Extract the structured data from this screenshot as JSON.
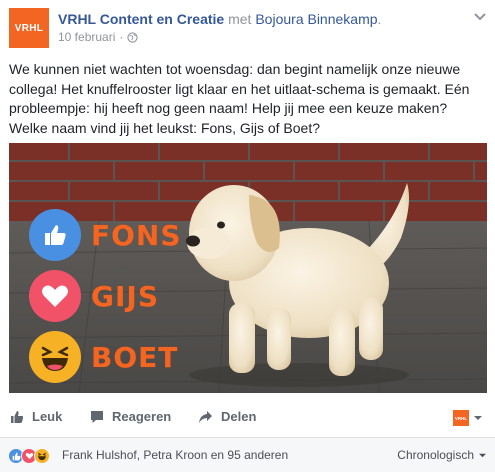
{
  "post": {
    "page_logo_text": "VRHL",
    "page_name": "VRHL Content en Creatie",
    "with_word": "met",
    "tagged_person": "Bojoura Binnekamp",
    "date": "10 februari",
    "separator": "·",
    "privacy_icon": "globe-icon",
    "text": "We kunnen niet wachten tot woensdag: dan begint namelijk onze nieuwe collega! Het knuffelrooster ligt klaar en het uitlaat-schema is gemaakt. Eén probleempje: hij heeft nog geen naam! Help jij mee een keuze maken? Welke naam vind jij het leukst: Fons, Gijs of Boet?"
  },
  "photo": {
    "options": [
      {
        "label": "FONS",
        "icon": "like-reaction-icon",
        "color": "#4a90e2"
      },
      {
        "label": "GIJS",
        "icon": "love-reaction-icon",
        "color": "#f25268"
      },
      {
        "label": "BOET",
        "icon": "haha-reaction-icon",
        "color": "#f7b125"
      }
    ]
  },
  "actions": {
    "like": "Leuk",
    "comment": "Reageren",
    "share": "Delen",
    "share_as_logo": "VRHL"
  },
  "footer": {
    "reaction_icons": [
      "like-icon",
      "love-icon",
      "haha-icon"
    ],
    "reactors_text": "Frank Hulshof, Petra Kroon en 95 anderen",
    "sort_label": "Chronologisch"
  },
  "colors": {
    "brand_orange": "#f26522",
    "link_blue": "#365899",
    "like_blue": "#4a90e2",
    "love_red": "#f25268",
    "haha_yellow": "#f7b125"
  }
}
